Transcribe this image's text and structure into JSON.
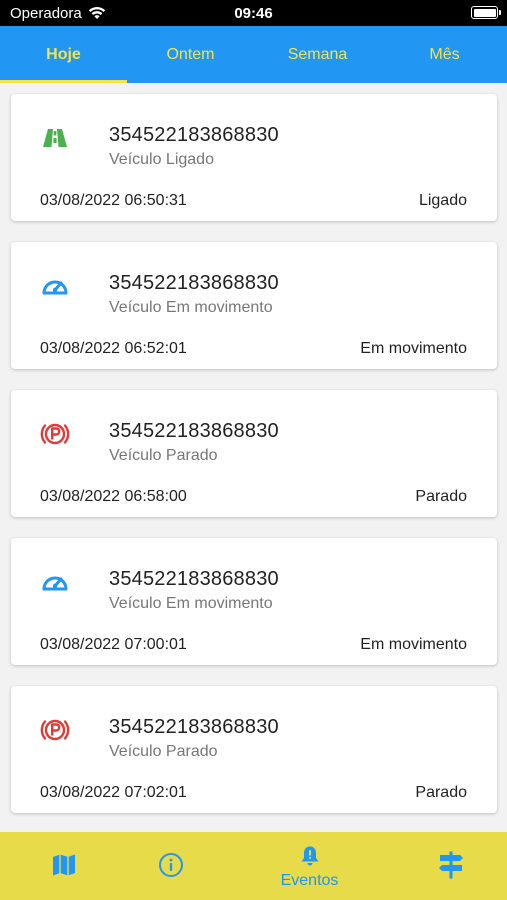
{
  "status_bar": {
    "carrier": "Operadora",
    "time": "09:46"
  },
  "tabs": [
    {
      "label": "Hoje",
      "active": true
    },
    {
      "label": "Ontem",
      "active": false
    },
    {
      "label": "Semana",
      "active": false
    },
    {
      "label": "Mês",
      "active": false
    }
  ],
  "events": [
    {
      "device": "354522183868830",
      "description": "Veículo Ligado",
      "datetime": "03/08/2022 06:50:31",
      "status": "Ligado",
      "icon": "road-icon"
    },
    {
      "device": "354522183868830",
      "description": "Veículo Em movimento",
      "datetime": "03/08/2022 06:52:01",
      "status": "Em movimento",
      "icon": "speedometer-icon"
    },
    {
      "device": "354522183868830",
      "description": "Veículo Parado",
      "datetime": "03/08/2022 06:58:00",
      "status": "Parado",
      "icon": "parking-icon"
    },
    {
      "device": "354522183868830",
      "description": "Veículo Em movimento",
      "datetime": "03/08/2022 07:00:01",
      "status": "Em movimento",
      "icon": "speedometer-icon"
    },
    {
      "device": "354522183868830",
      "description": "Veículo Parado",
      "datetime": "03/08/2022 07:02:01",
      "status": "Parado",
      "icon": "parking-icon"
    }
  ],
  "bottom_nav": [
    {
      "icon": "map-icon",
      "label": ""
    },
    {
      "icon": "info-icon",
      "label": ""
    },
    {
      "icon": "bell-icon",
      "label": "Eventos",
      "active": true
    },
    {
      "icon": "signpost-icon",
      "label": ""
    }
  ],
  "colors": {
    "primary": "#2196f3",
    "accent": "#f5e34b",
    "bottom_nav_bg": "#e8db4a",
    "road_icon": "#4caf50",
    "speedometer_icon": "#2196f3",
    "parking_icon": "#e53935"
  }
}
